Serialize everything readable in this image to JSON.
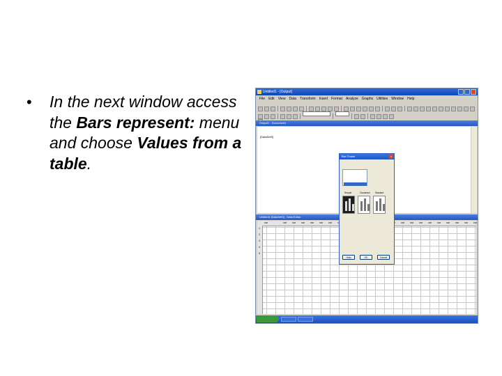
{
  "slide": {
    "bullet": "•",
    "text_parts": [
      {
        "t": "In the next window access the ",
        "b": false
      },
      {
        "t": "Bars represent:",
        "b": true
      },
      {
        "t": " menu and choose ",
        "b": false
      },
      {
        "t": "Values from a table",
        "b": true
      },
      {
        "t": ".",
        "b": false
      }
    ]
  },
  "screenshot": {
    "window_title": "Untitled1 - [Output]",
    "menu": [
      "File",
      "Edit",
      "View",
      "Data",
      "Transform",
      "Insert",
      "Format",
      "Analyze",
      "Graphs",
      "Utilities",
      "Window",
      "Help"
    ],
    "output_title": "Output1 - Document1",
    "section_header": "[DataSet0]",
    "output_line": "",
    "sheet_title": "Untitled1 [DataSet0] - Data Editor",
    "columns": [
      "",
      "var",
      "var",
      "var",
      "var",
      "var",
      "var",
      "var",
      "var",
      "var",
      "var",
      "var",
      "var",
      "var",
      "var",
      "var",
      "var",
      "var",
      "var",
      "var",
      "var",
      "var",
      "var",
      "var"
    ],
    "rows": [
      {
        "num": "1",
        "c1": "",
        "c2": ""
      },
      {
        "num": "2",
        "c1": "",
        "c2": ""
      },
      {
        "num": "3",
        "c1": "",
        "c2": ""
      },
      {
        "num": "4",
        "c1": "",
        "c2": ""
      },
      {
        "num": "5",
        "c1": "",
        "c2": ""
      }
    ],
    "dialog": {
      "title": "Bar Charts",
      "label": "",
      "options": [
        {
          "label": "",
          "selected": false
        },
        {
          "label": "",
          "selected": false
        },
        {
          "label": "",
          "selected": false
        },
        {
          "label": "",
          "selected": true
        }
      ],
      "charts": [
        {
          "label": "Simple",
          "selected": true
        },
        {
          "label": "Clustered",
          "selected": false
        },
        {
          "label": "Stacked",
          "selected": false
        }
      ],
      "buttons": [
        "Help",
        "OK",
        "Cancel"
      ]
    }
  }
}
